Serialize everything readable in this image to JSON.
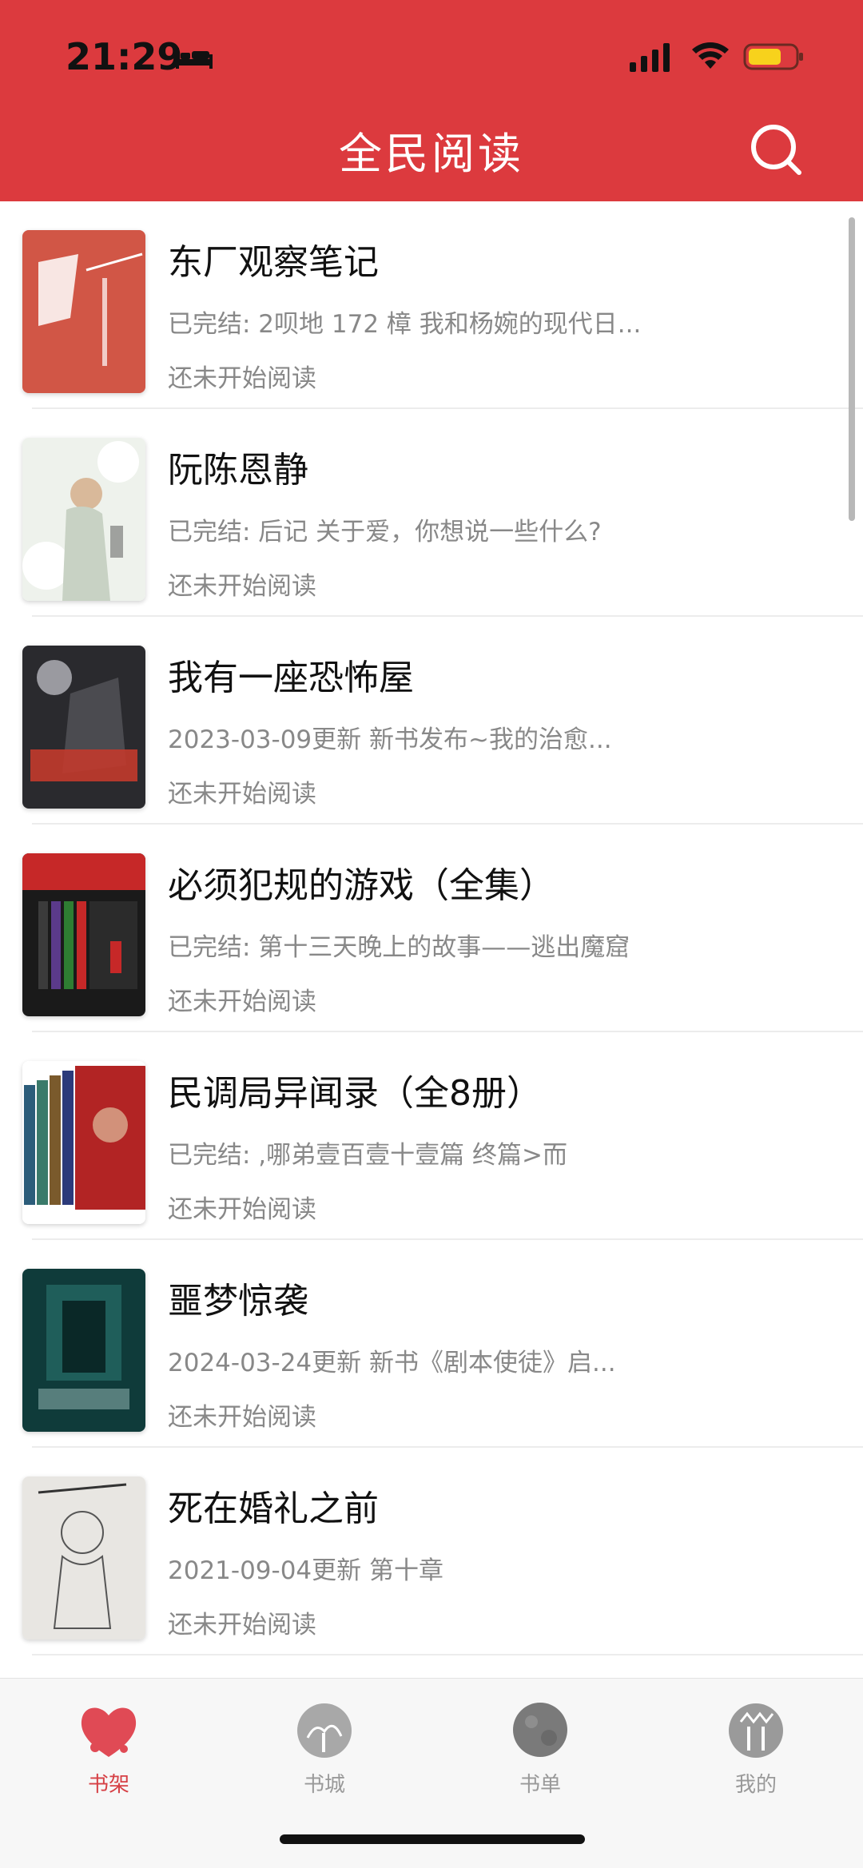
{
  "status_bar": {
    "time": "21:29"
  },
  "header": {
    "title": "全民阅读",
    "search_icon": "search-icon"
  },
  "books": [
    {
      "title": "东厂观察笔记",
      "subtitle": "已完结: 2呗地 172 樟 我和杨婉的现代日...",
      "status": "还未开始阅读"
    },
    {
      "title": "阮陈恩静",
      "subtitle": "已完结: 后记 关于爱，你想说一些什么?",
      "status": "还未开始阅读"
    },
    {
      "title": "我有一座恐怖屋",
      "subtitle": "2023-03-09更新 新书发布~我的治愈...",
      "status": "还未开始阅读"
    },
    {
      "title": "必须犯规的游戏（全集）",
      "subtitle": "已完结: 第十三天晚上的故事——逃出魔窟",
      "status": "还未开始阅读"
    },
    {
      "title": "民调局异闻录（全8册）",
      "subtitle": "已完结: ,哪弟壹百壹十壹篇 终篇>而",
      "status": "还未开始阅读"
    },
    {
      "title": "噩梦惊袭",
      "subtitle": "2024-03-24更新 新书《剧本使徒》启...",
      "status": "还未开始阅读"
    },
    {
      "title": "死在婚礼之前",
      "subtitle": "2021-09-04更新 第十章",
      "status": "还未开始阅读"
    }
  ],
  "tabs": [
    {
      "label": "书架",
      "active": true
    },
    {
      "label": "书城",
      "active": false
    },
    {
      "label": "书单",
      "active": false
    },
    {
      "label": "我的",
      "active": false
    }
  ],
  "colors": {
    "brand": "#dc3a3e",
    "active_tab": "#d64045",
    "inactive_tab": "#999999"
  }
}
